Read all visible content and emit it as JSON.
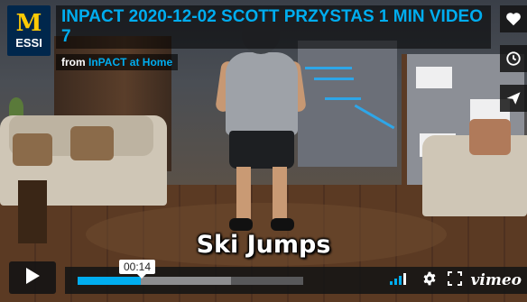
{
  "video": {
    "title": "INPACT 2020-12-02 SCOTT PRZYSTAS 1 MIN VIDEO 7",
    "byline_from": "from",
    "byline_owner": "InPACT at Home",
    "caption": "Ski Jumps"
  },
  "badge": {
    "letter": "M",
    "text": "ESSI"
  },
  "side_actions": [
    {
      "icon": "heart-icon"
    },
    {
      "icon": "clock-icon"
    },
    {
      "icon": "paper-plane-icon"
    }
  ],
  "controls": {
    "play_icon": "play-icon",
    "current_time": "00:14",
    "progress_played": 0.28,
    "progress_loaded": 0.68,
    "volume_icon": "volume-bars-icon",
    "settings_icon": "gear-icon",
    "fullscreen_icon": "fullscreen-icon",
    "brand": "vimeo"
  },
  "colors": {
    "accent": "#00adef",
    "badge_bg": "#00274c",
    "badge_letter": "#ffcb05"
  }
}
